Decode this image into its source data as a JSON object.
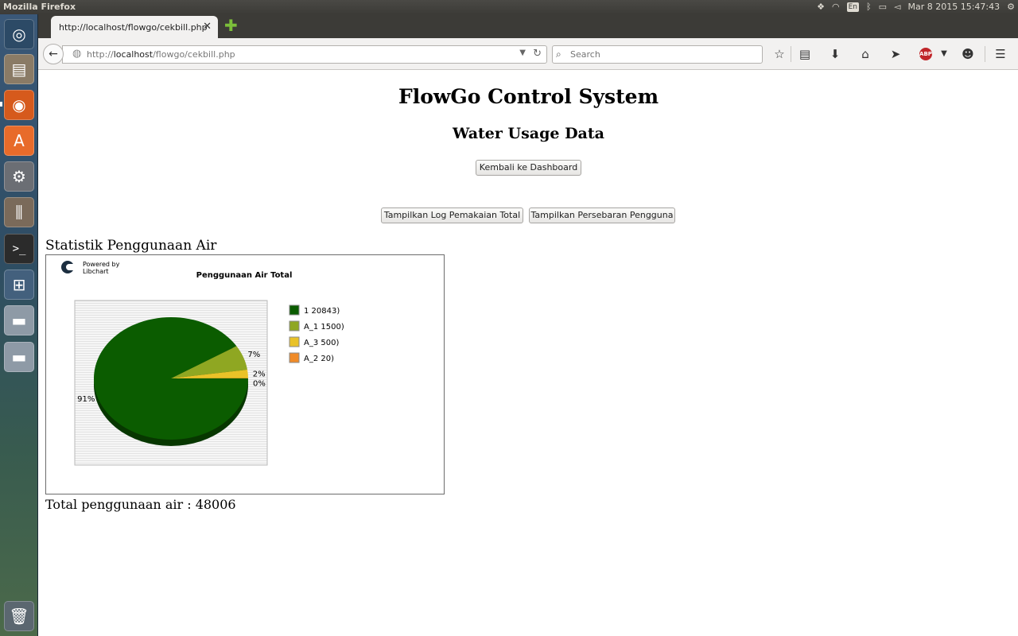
{
  "panel": {
    "app_title": "Mozilla Firefox",
    "keyboard_lang": "En",
    "datetime": "Mar 8 2015 15:47:43"
  },
  "browser": {
    "tab_title": "http://localhost/flowgo/cekbill.php",
    "url_prefix": "http://",
    "url_host": "localhost",
    "url_path": "/flowgo/cekbill.php",
    "search_placeholder": "Search",
    "adblock_label": "ABP"
  },
  "page": {
    "title": "FlowGo Control System",
    "subtitle": "Water Usage Data",
    "buttons": {
      "dashboard": "Kembali ke Dashboard",
      "log_total": "Tampilkan Log Pemakaian Total",
      "persebaran": "Tampilkan Persebaran Pengguna"
    },
    "stat_heading": "Statistik Penggunaan Air",
    "total_label": "Total penggunaan air : ",
    "total_value": "48006"
  },
  "chart_data": {
    "type": "pie",
    "title": "Penggunaan Air Total",
    "branding": [
      "Powered by",
      "Libchart"
    ],
    "slices": [
      {
        "label": "1 20843)",
        "value": 20843,
        "percent_label": "91%",
        "color": "#0b5c00"
      },
      {
        "label": "A_1 1500)",
        "value": 1500,
        "percent_label": "7%",
        "color": "#8fa722"
      },
      {
        "label": "A_3 500)",
        "value": 500,
        "percent_label": "2%",
        "color": "#e9c228"
      },
      {
        "label": "A_2 20)",
        "value": 20,
        "percent_label": "0%",
        "color": "#f08b28"
      }
    ],
    "legend_placement": "right"
  }
}
